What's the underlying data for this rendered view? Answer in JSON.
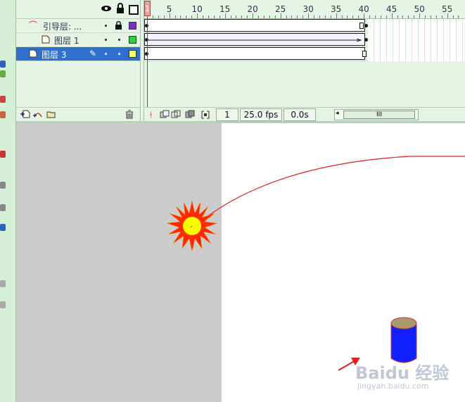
{
  "timeline": {
    "header_icons": [
      "eye-icon",
      "lock-icon",
      "outline-icon"
    ],
    "layers": [
      {
        "name": "引导层: ...",
        "type": "guide",
        "color": "#7a2fc0",
        "selected": false
      },
      {
        "name": "图层 1",
        "type": "layer",
        "color": "#33cc44",
        "selected": false
      },
      {
        "name": "图层 3",
        "type": "layer",
        "color": "#ffff66",
        "selected": true
      }
    ],
    "ruler_numbers": [
      "1",
      "5",
      "10",
      "15",
      "20",
      "25",
      "30",
      "35",
      "40",
      "45",
      "50",
      "55"
    ],
    "status": {
      "current_frame": "1",
      "fps": "25.0 fps",
      "elapsed": "0.0s",
      "scroll_label": "III"
    }
  },
  "watermark": {
    "brand": "Baidu 经验",
    "url": "jingyan.baidu.com"
  },
  "colors": {
    "motion_path": "#e02020",
    "sun_outer": "#ff2a00",
    "sun_inner": "#ffff00",
    "cylinder": "#1020ff",
    "arrow": "#e02020"
  }
}
